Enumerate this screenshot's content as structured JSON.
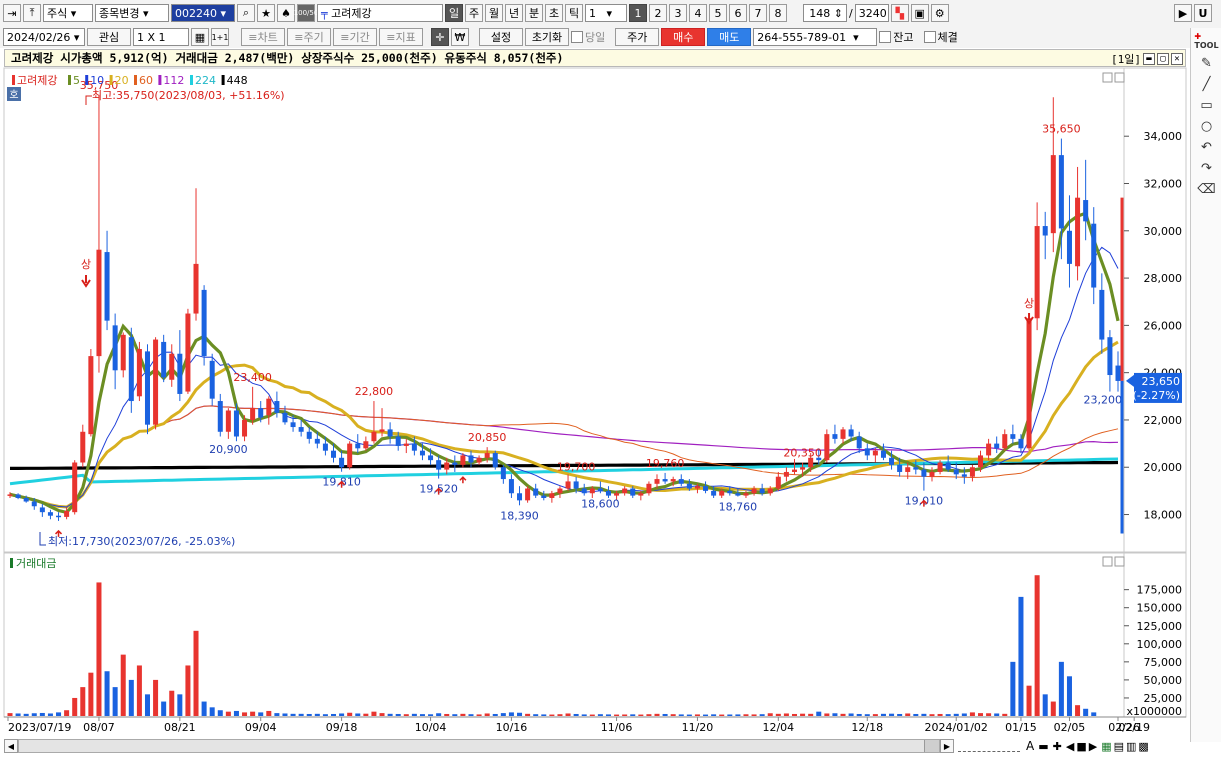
{
  "toolbar1": {
    "market": "주식",
    "code_mode": "종목변경",
    "code": "002240",
    "stock_name": "고려제강",
    "period_buttons": [
      "일",
      "주",
      "월",
      "년",
      "분",
      "초",
      "틱"
    ],
    "period_value": "1",
    "pages": [
      "1",
      "2",
      "3",
      "4",
      "5",
      "6",
      "7",
      "8"
    ],
    "count": "148",
    "total": "3240",
    "ratio_icon": "100/50"
  },
  "toolbar2": {
    "date": "2024/02/26",
    "watch": "관심",
    "layout": "1 X 1",
    "layout_small": "1+1",
    "chart_btn": "≡차트",
    "period_btn": "≡주기",
    "range_btn": "≡기간",
    "indicator_btn": "≡지표",
    "won": "₩",
    "settings": "설정",
    "reset": "초기화",
    "today": "당일",
    "price": "주가",
    "buy": "매수",
    "sell": "매도",
    "account": "264-555-789-01",
    "balance": "잔고",
    "executed": "체결"
  },
  "info": {
    "summary": "고려제강  시가총액 5,912(억) 거래대금 2,487(백만) 상장주식수 25,000(천주) 유동주식 8,057(천주)",
    "period": "[1일]"
  },
  "chart_data": {
    "type": "candlestick",
    "title": "고려제강",
    "legend": [
      {
        "name": "고려제강",
        "color": "#e8342f"
      },
      {
        "name": "5",
        "color": "#6b8e23"
      },
      {
        "name": "10",
        "color": "#1f3fd8"
      },
      {
        "name": "20",
        "color": "#d8b020"
      },
      {
        "name": "60",
        "color": "#e06020"
      },
      {
        "name": "112",
        "color": "#a020c0"
      },
      {
        "name": "224",
        "color": "#20d0e0"
      },
      {
        "name": "448",
        "color": "#000000"
      }
    ],
    "yticks": [
      "18,000",
      "20,000",
      "22,000",
      "24,000",
      "26,000",
      "28,000",
      "30,000",
      "32,000",
      "34,000"
    ],
    "ylim": [
      16500,
      36800
    ],
    "x_labels": [
      "2023/07/19",
      "08/07",
      "08/21",
      "09/04",
      "09/18",
      "10/04",
      "10/16",
      "11/06",
      "11/20",
      "12/04",
      "12/18",
      "2024/01/02",
      "01/15",
      "02/05",
      "02/19",
      "02/26"
    ],
    "annotations": {
      "high": "최고:35,750(2023/08/03, +51.16%)",
      "low": "최저:17,730(2023/07/26, -25.03%)",
      "upper_limit": "상",
      "upper_limit_2": "상",
      "labels": [
        "35,750",
        "23,400",
        "20,900",
        "19,810",
        "22,800",
        "19,520",
        "20,850",
        "19,700",
        "18,390",
        "19,760",
        "18,600",
        "18,760",
        "20,350",
        "19,010",
        "35,650",
        "23,200"
      ]
    },
    "current_price": "23,650",
    "current_change": "(-2.27%)",
    "volume_title": "거래대금",
    "volume_yticks": [
      "25,000",
      "50,000",
      "75,000",
      "100,000",
      "125,000",
      "150,000",
      "175,000"
    ],
    "volume_unit": "x1000000",
    "ohlc": [
      [
        18800,
        18950,
        18700,
        18850
      ],
      [
        18850,
        18900,
        18650,
        18700
      ],
      [
        18700,
        18800,
        18500,
        18550
      ],
      [
        18550,
        18700,
        18200,
        18350
      ],
      [
        18300,
        18450,
        17900,
        18100
      ],
      [
        18100,
        18200,
        17800,
        17950
      ],
      [
        17950,
        18100,
        17730,
        17900
      ],
      [
        17900,
        18300,
        17800,
        18150
      ],
      [
        18100,
        20300,
        18000,
        20200
      ],
      [
        20200,
        21800,
        20000,
        21500
      ],
      [
        21400,
        25000,
        21300,
        24700
      ],
      [
        24700,
        35750,
        24000,
        29200
      ],
      [
        29100,
        30000,
        25800,
        26200
      ],
      [
        26000,
        26500,
        23300,
        24100
      ],
      [
        24100,
        25700,
        23800,
        25600
      ],
      [
        25500,
        25900,
        22300,
        22800
      ],
      [
        23000,
        25300,
        22800,
        25000
      ],
      [
        24900,
        25200,
        21400,
        21800
      ],
      [
        21800,
        25500,
        21600,
        25400
      ],
      [
        25300,
        25600,
        23600,
        23800
      ],
      [
        23700,
        25200,
        23400,
        24800
      ],
      [
        24800,
        25800,
        22800,
        23100
      ],
      [
        23200,
        26700,
        23100,
        26500
      ],
      [
        26500,
        31800,
        26200,
        28600
      ],
      [
        27500,
        27700,
        24300,
        24700
      ],
      [
        24500,
        24800,
        22600,
        22900
      ],
      [
        22800,
        23100,
        21300,
        21500
      ],
      [
        21500,
        22500,
        21200,
        22400
      ],
      [
        22400,
        22700,
        21100,
        21300
      ],
      [
        21300,
        22200,
        21100,
        22000
      ],
      [
        22000,
        23400,
        21800,
        22500
      ],
      [
        22500,
        22800,
        21900,
        22100
      ],
      [
        22200,
        23000,
        21800,
        22900
      ],
      [
        22800,
        23200,
        22100,
        22300
      ],
      [
        22300,
        22600,
        21800,
        21900
      ],
      [
        21900,
        22200,
        21500,
        21700
      ],
      [
        21700,
        22000,
        21300,
        21500
      ],
      [
        21500,
        21700,
        21000,
        21200
      ],
      [
        21200,
        21500,
        20800,
        21000
      ],
      [
        21000,
        21300,
        20500,
        20700
      ],
      [
        20700,
        21000,
        20200,
        20400
      ],
      [
        20400,
        20700,
        19810,
        20000
      ],
      [
        20000,
        21100,
        19900,
        21000
      ],
      [
        21000,
        21400,
        20600,
        20800
      ],
      [
        20800,
        21300,
        20700,
        21100
      ],
      [
        21100,
        22800,
        21000,
        21500
      ],
      [
        21500,
        22500,
        21300,
        21600
      ],
      [
        21600,
        21900,
        21000,
        21300
      ],
      [
        21300,
        21500,
        20700,
        20900
      ],
      [
        20900,
        21200,
        20600,
        21000
      ],
      [
        21000,
        21300,
        20500,
        20700
      ],
      [
        20700,
        21000,
        20300,
        20500
      ],
      [
        20500,
        20800,
        20100,
        20300
      ],
      [
        20300,
        20500,
        19520,
        19900
      ],
      [
        19900,
        20400,
        19700,
        20200
      ],
      [
        20200,
        20500,
        19800,
        20100
      ],
      [
        20100,
        20600,
        20000,
        20500
      ],
      [
        20500,
        20700,
        20000,
        20200
      ],
      [
        20200,
        20500,
        20100,
        20400
      ],
      [
        20400,
        20850,
        20200,
        20600
      ],
      [
        20600,
        20700,
        19900,
        20000
      ],
      [
        20000,
        20100,
        19300,
        19500
      ],
      [
        19500,
        19700,
        18700,
        18900
      ],
      [
        18900,
        19200,
        18390,
        18600
      ],
      [
        18600,
        19200,
        18500,
        19100
      ],
      [
        19100,
        19300,
        18700,
        18800
      ],
      [
        18800,
        19000,
        18600,
        18700
      ],
      [
        18700,
        19000,
        18500,
        18900
      ],
      [
        18900,
        19200,
        18700,
        19100
      ],
      [
        19100,
        19700,
        19000,
        19400
      ],
      [
        19400,
        19600,
        18900,
        19100
      ],
      [
        19100,
        19300,
        18800,
        18900
      ],
      [
        18900,
        19200,
        18700,
        19100
      ],
      [
        19100,
        19400,
        18900,
        19000
      ],
      [
        19000,
        19200,
        18700,
        18800
      ],
      [
        18800,
        19000,
        18600,
        18900
      ],
      [
        18900,
        19200,
        18800,
        19100
      ],
      [
        19100,
        19200,
        18700,
        18800
      ],
      [
        18800,
        19000,
        18600,
        18900
      ],
      [
        18900,
        19400,
        18800,
        19300
      ],
      [
        19300,
        19700,
        19100,
        19500
      ],
      [
        19500,
        19760,
        19300,
        19400
      ],
      [
        19400,
        19600,
        19200,
        19500
      ],
      [
        19500,
        19700,
        19200,
        19300
      ],
      [
        19300,
        19500,
        19000,
        19100
      ],
      [
        19100,
        19300,
        18900,
        19200
      ],
      [
        19200,
        19400,
        18900,
        19000
      ],
      [
        19000,
        19200,
        18700,
        18800
      ],
      [
        18800,
        19100,
        18700,
        19000
      ],
      [
        19000,
        19200,
        18800,
        18900
      ],
      [
        18900,
        19100,
        18760,
        18800
      ],
      [
        18800,
        19000,
        18700,
        18900
      ],
      [
        18900,
        19200,
        18800,
        19100
      ],
      [
        19100,
        19300,
        18800,
        18900
      ],
      [
        18900,
        19200,
        18800,
        19100
      ],
      [
        19100,
        19800,
        19000,
        19600
      ],
      [
        19600,
        20000,
        19400,
        19800
      ],
      [
        19800,
        20350,
        19700,
        19900
      ],
      [
        19900,
        20200,
        19600,
        20000
      ],
      [
        20000,
        20600,
        19800,
        20400
      ],
      [
        20400,
        20800,
        20100,
        20300
      ],
      [
        20300,
        21600,
        20200,
        21400
      ],
      [
        21400,
        21800,
        21000,
        21200
      ],
      [
        21200,
        21700,
        21000,
        21600
      ],
      [
        21600,
        21800,
        21100,
        21300
      ],
      [
        21300,
        21500,
        20600,
        20800
      ],
      [
        20800,
        21000,
        20300,
        20500
      ],
      [
        20500,
        20800,
        20200,
        20700
      ],
      [
        20700,
        21000,
        20300,
        20400
      ],
      [
        20400,
        20700,
        19900,
        20100
      ],
      [
        20100,
        20400,
        19600,
        19800
      ],
      [
        19800,
        20200,
        19500,
        20000
      ],
      [
        20000,
        20300,
        19700,
        19900
      ],
      [
        19900,
        20200,
        19010,
        19600
      ],
      [
        19600,
        20000,
        19400,
        19800
      ],
      [
        19800,
        20300,
        19700,
        20200
      ],
      [
        20200,
        20500,
        19800,
        19900
      ],
      [
        19900,
        20200,
        19500,
        19700
      ],
      [
        19700,
        20000,
        19300,
        19600
      ],
      [
        19600,
        20100,
        19400,
        20000
      ],
      [
        20000,
        20700,
        19800,
        20500
      ],
      [
        20500,
        21200,
        20300,
        21000
      ],
      [
        21000,
        21300,
        20600,
        20800
      ],
      [
        20800,
        21600,
        20700,
        21400
      ],
      [
        21400,
        21800,
        21000,
        21200
      ],
      [
        21200,
        21400,
        20600,
        20800
      ],
      [
        20800,
        26500,
        20700,
        26300
      ],
      [
        26300,
        31200,
        25800,
        30200
      ],
      [
        30200,
        30800,
        28800,
        29800
      ],
      [
        29900,
        35650,
        29100,
        33200
      ],
      [
        33200,
        33900,
        28800,
        30100
      ],
      [
        30000,
        31500,
        27600,
        28600
      ],
      [
        28500,
        32700,
        27900,
        31400
      ],
      [
        31300,
        33000,
        29600,
        30400
      ],
      [
        30300,
        31000,
        26900,
        27600
      ],
      [
        27500,
        28200,
        24800,
        25400
      ],
      [
        25500,
        25800,
        23200,
        23900
      ],
      [
        24300,
        24900,
        23200,
        23650
      ]
    ],
    "volume": [
      4000,
      3500,
      3000,
      3800,
      4200,
      3500,
      5000,
      8000,
      25000,
      40000,
      60000,
      185000,
      62000,
      40000,
      85000,
      50000,
      70000,
      30000,
      50000,
      20000,
      35000,
      30000,
      70000,
      118000,
      20000,
      12000,
      8000,
      6000,
      7000,
      5000,
      6000,
      5000,
      7000,
      4000,
      3500,
      3000,
      3000,
      2800,
      3000,
      2500,
      2800,
      3500,
      4500,
      3500,
      3200,
      6000,
      4000,
      3000,
      2800,
      2500,
      3000,
      2600,
      2400,
      3800,
      2800,
      2500,
      3000,
      2500,
      2200,
      3500,
      2800,
      4000,
      5000,
      4500,
      3000,
      2500,
      2200,
      2000,
      2500,
      3500,
      2800,
      2200,
      2000,
      2500,
      2200,
      2000,
      2100,
      2300,
      2000,
      2500,
      3000,
      2800,
      2500,
      2200,
      2000,
      2200,
      2000,
      2300,
      2000,
      2100,
      2200,
      2400,
      2200,
      2500,
      3800,
      3000,
      3500,
      2800,
      3200,
      3000,
      6000,
      3500,
      3800,
      3000,
      3500,
      2800,
      2500,
      2600,
      3000,
      3200,
      2800,
      3500,
      2800,
      3000,
      2500,
      2800,
      2600,
      3000,
      3500,
      5000,
      4000,
      3800,
      3500,
      3000,
      75000,
      165000,
      42000,
      195000,
      30000,
      20000,
      75000,
      55000,
      15000,
      10000,
      5000
    ]
  },
  "bottom": {
    "font_btn": "A",
    "unit_label": "x1000000"
  }
}
